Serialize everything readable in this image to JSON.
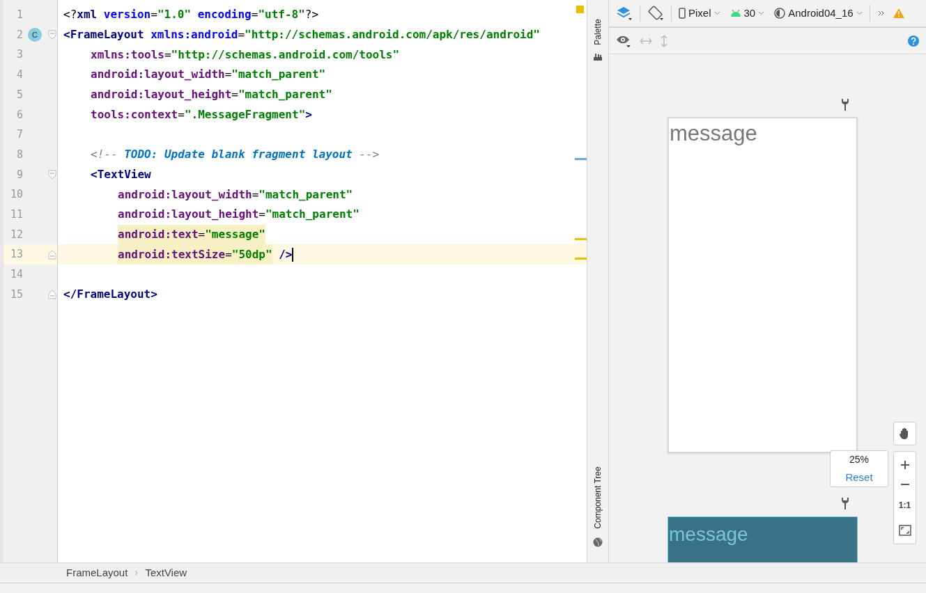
{
  "editor": {
    "lines": [
      {
        "number": "1",
        "current": false,
        "tokens": [
          {
            "kind": "punct",
            "text": "<?"
          },
          {
            "kind": "tag",
            "text": "xml"
          },
          {
            "kind": "ns_attr",
            "text": " version"
          },
          {
            "kind": "punct",
            "text": "="
          },
          {
            "kind": "value",
            "text": "\"1.0\""
          },
          {
            "kind": "ns_attr",
            "text": " encoding"
          },
          {
            "kind": "punct",
            "text": "="
          },
          {
            "kind": "value",
            "text": "\"utf-8\""
          },
          {
            "kind": "punct",
            "text": "?>"
          }
        ]
      },
      {
        "number": "2",
        "fold_start": true,
        "badge": "C",
        "current": false,
        "tokens": [
          {
            "kind": "tag",
            "text": "<FrameLayout"
          },
          {
            "kind": "ns_attr",
            "text": " xmlns:android"
          },
          {
            "kind": "punct",
            "text": "="
          },
          {
            "kind": "value",
            "text": "\"http://schemas.android.com/apk/res/android\""
          }
        ],
        "children": [
          {
            "number": "3",
            "current": false,
            "tokens": [
              {
                "kind": "attr",
                "text": "xmlns:tools"
              },
              {
                "kind": "punct",
                "text": "="
              },
              {
                "kind": "value",
                "text": "\"http://schemas.android.com/tools\""
              }
            ]
          },
          {
            "number": "4",
            "current": false,
            "tokens": [
              {
                "kind": "attr",
                "text": "android:layout_width"
              },
              {
                "kind": "punct",
                "text": "="
              },
              {
                "kind": "value",
                "text": "\"match_parent\""
              }
            ]
          },
          {
            "number": "5",
            "current": false,
            "tokens": [
              {
                "kind": "attr",
                "text": "android:layout_height"
              },
              {
                "kind": "punct",
                "text": "="
              },
              {
                "kind": "value",
                "text": "\"match_parent\""
              }
            ]
          },
          {
            "number": "6",
            "current": false,
            "tokens": [
              {
                "kind": "attr",
                "text": "tools:context"
              },
              {
                "kind": "punct",
                "text": "="
              },
              {
                "kind": "value",
                "text": "\".MessageFragment\""
              },
              {
                "kind": "tag",
                "text": ">"
              }
            ]
          },
          {
            "number": "7",
            "current": false
          },
          {
            "number": "8",
            "current": false,
            "tokens": [
              {
                "kind": "comment",
                "text": "<!-- "
              },
              {
                "kind": "todo",
                "text": "TODO: Update blank fragment layout"
              },
              {
                "kind": "comment",
                "text": " -->"
              }
            ]
          },
          {
            "number": "9",
            "fold_start": true,
            "current": false,
            "tokens": [
              {
                "kind": "tag",
                "text": "<TextView"
              }
            ],
            "children": [
              {
                "number": "10",
                "current": false,
                "tokens": [
                  {
                    "kind": "attr",
                    "text": "android:layout_width"
                  },
                  {
                    "kind": "punct",
                    "text": "="
                  },
                  {
                    "kind": "value",
                    "text": "\"match_parent\""
                  }
                ]
              },
              {
                "number": "11",
                "current": false,
                "tokens": [
                  {
                    "kind": "attr",
                    "text": "android:layout_height"
                  },
                  {
                    "kind": "punct",
                    "text": "="
                  },
                  {
                    "kind": "value",
                    "text": "\"match_parent\""
                  }
                ]
              },
              {
                "number": "12",
                "current": false,
                "highlighted": [
                  {
                    "kind": "attr",
                    "text": "android:text"
                  },
                  {
                    "kind": "punct",
                    "text": "="
                  },
                  {
                    "kind": "value",
                    "text": "\"message\""
                  }
                ]
              },
              {
                "number": "13",
                "fold_end": true,
                "current": true,
                "highlighted": [
                  {
                    "kind": "attr",
                    "text": "android:textSize"
                  },
                  {
                    "kind": "punct",
                    "text": "="
                  },
                  {
                    "kind": "value",
                    "text": "\"50dp\""
                  }
                ],
                "tokens": [
                  {
                    "kind": "tag",
                    "text": " />"
                  }
                ]
              }
            ]
          }
        ]
      },
      {
        "number": "14",
        "current": false
      },
      {
        "number": "15",
        "fold_end": true,
        "current": false,
        "tokens": [
          {
            "kind": "tag",
            "text": "</FrameLayout>"
          }
        ]
      }
    ]
  },
  "side_tabs": {
    "top": "Palette",
    "bottom": "Component Tree"
  },
  "toolbar": {
    "device": "Pixel",
    "api": "30",
    "theme": "Android04_16"
  },
  "preview": {
    "design_text": "message",
    "blueprint_text": "message"
  },
  "zoom": {
    "percent": "25%",
    "reset": "Reset",
    "actual_size": "1:1"
  },
  "breadcrumb": [
    "FrameLayout",
    "TextView"
  ]
}
